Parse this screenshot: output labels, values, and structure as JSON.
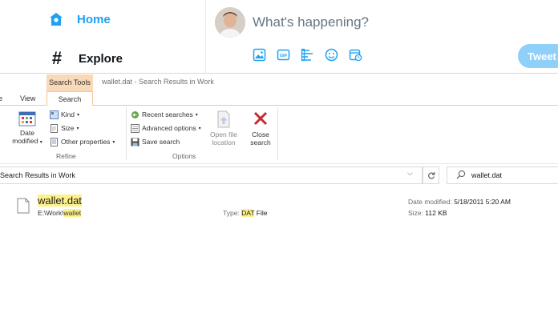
{
  "twitter": {
    "nav": [
      {
        "label": "Home",
        "icon": "home-icon"
      },
      {
        "label": "Explore",
        "icon": "hashtag-icon"
      }
    ],
    "compose_placeholder": "What's happening?",
    "tweet_button": "Tweet",
    "accent": "#1da1f2",
    "compose_tools": [
      "image-icon",
      "gif-icon",
      "poll-icon",
      "emoji-icon",
      "schedule-icon"
    ],
    "gif_label": "GIF"
  },
  "explorer": {
    "context_tab": "Search Tools",
    "window_title": "wallet.dat - Search Results in Work",
    "tabs": [
      "e",
      "View",
      "Search"
    ],
    "ribbon": {
      "date_modified": "Date modified",
      "date_line1": "Date",
      "date_line2": "modified",
      "kind": "Kind",
      "size": "Size",
      "other_properties": "Other properties",
      "refine": "Refine",
      "recent_searches": "Recent searches",
      "advanced_options": "Advanced options",
      "save_search": "Save search",
      "open_file_location_1": "Open file",
      "open_file_location_2": "location",
      "options": "Options",
      "close_search_1": "Close",
      "close_search_2": "search"
    },
    "address": "Search Results in Work",
    "search_query": "wallet.dat",
    "result": {
      "name": "wallet.dat",
      "path_prefix": "E:\\Work\\",
      "path_hl": "wallet",
      "type_label": "Type:",
      "type_hl": "DAT",
      "type_rest": "File",
      "date_label": "Date modified:",
      "date_value": "5/18/2011 5:20 AM",
      "size_label": "Size:",
      "size_value": "112 KB"
    },
    "highlight_color": "#fdf18a",
    "context_tab_color": "#f9d9b8"
  }
}
